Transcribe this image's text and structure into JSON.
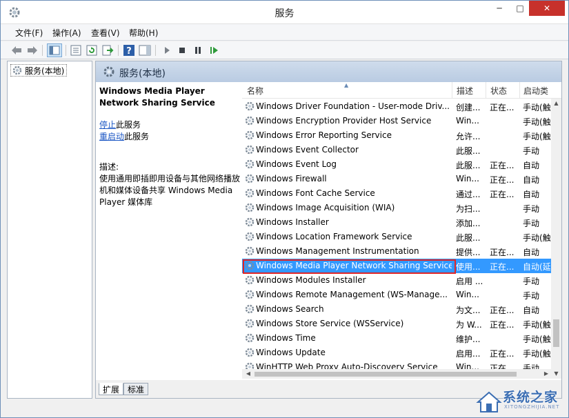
{
  "window": {
    "title": "服务"
  },
  "caption": {
    "minimize": "─",
    "maximize": "□",
    "close": "✕"
  },
  "menu": [
    {
      "label": "文件(F)"
    },
    {
      "label": "操作(A)"
    },
    {
      "label": "查看(V)"
    },
    {
      "label": "帮助(H)"
    }
  ],
  "toolbar": {
    "icons": [
      "back-arrow-icon",
      "forward-arrow-icon",
      "show-hide-console-tree-icon",
      "properties-icon",
      "refresh-icon",
      "export-list-icon",
      "help-icon",
      "show-hide-action-pane-icon",
      "start-service-icon",
      "stop-service-icon",
      "pause-service-icon",
      "restart-service-icon"
    ]
  },
  "tree": {
    "root_label": "服务(本地)"
  },
  "panel": {
    "title": "服务(本地)"
  },
  "description": {
    "service_name": "Windows Media Player Network Sharing Service",
    "stop_link": "停止",
    "stop_suffix": "此服务",
    "restart_link": "重启动",
    "restart_suffix": "此服务",
    "label": "描述:",
    "text": "使用通用即插即用设备与其他网络播放机和媒体设备共享 Windows Media Player 媒体库"
  },
  "columns": {
    "name": "名称",
    "description": "描述",
    "status": "状态",
    "startup": "启动类"
  },
  "services": [
    {
      "name": "Windows Driver Foundation - User-mode Driv...",
      "description": "创建...",
      "status": "正在...",
      "startup": "手动(触"
    },
    {
      "name": "Windows Encryption Provider Host Service",
      "description": "Win...",
      "status": "",
      "startup": "手动(触"
    },
    {
      "name": "Windows Error Reporting Service",
      "description": "允许...",
      "status": "",
      "startup": "手动(触"
    },
    {
      "name": "Windows Event Collector",
      "description": "此服...",
      "status": "",
      "startup": "手动"
    },
    {
      "name": "Windows Event Log",
      "description": "此服...",
      "status": "正在...",
      "startup": "自动"
    },
    {
      "name": "Windows Firewall",
      "description": "Win...",
      "status": "正在...",
      "startup": "自动"
    },
    {
      "name": "Windows Font Cache Service",
      "description": "通过...",
      "status": "正在...",
      "startup": "自动"
    },
    {
      "name": "Windows Image Acquisition (WIA)",
      "description": "为扫...",
      "status": "",
      "startup": "手动"
    },
    {
      "name": "Windows Installer",
      "description": "添加...",
      "status": "",
      "startup": "手动"
    },
    {
      "name": "Windows Location Framework Service",
      "description": "此服...",
      "status": "",
      "startup": "手动(触"
    },
    {
      "name": "Windows Management Instrumentation",
      "description": "提供...",
      "status": "正在...",
      "startup": "自动"
    },
    {
      "name": "Windows Media Player Network Sharing Service",
      "description": "使用...",
      "status": "正在...",
      "startup": "自动(延"
    },
    {
      "name": "Windows Modules Installer",
      "description": "启用 ...",
      "status": "",
      "startup": "手动"
    },
    {
      "name": "Windows Remote Management (WS-Manage...",
      "description": "Win...",
      "status": "",
      "startup": "手动"
    },
    {
      "name": "Windows Search",
      "description": "为文...",
      "status": "正在...",
      "startup": "自动"
    },
    {
      "name": "Windows Store Service (WSService)",
      "description": "为 W...",
      "status": "正在...",
      "startup": "手动(触"
    },
    {
      "name": "Windows Time",
      "description": "维护...",
      "status": "",
      "startup": "手动(触"
    },
    {
      "name": "Windows Update",
      "description": "启用...",
      "status": "正在...",
      "startup": "手动(触"
    },
    {
      "name": "WinHTTP Web Proxy Auto-Discovery Service",
      "description": "Win...",
      "status": "正在...",
      "startup": "手动"
    }
  ],
  "selected_index": 11,
  "tabs": [
    {
      "label": "扩展"
    },
    {
      "label": "标准"
    }
  ],
  "watermark": {
    "text": "系统之家",
    "sub": "XITONGZHIJIA.NET"
  },
  "colors": {
    "selection": "#3399ff",
    "highlight_box": "#e02424",
    "link": "#1a56c4",
    "close_button": "#c7312b"
  }
}
